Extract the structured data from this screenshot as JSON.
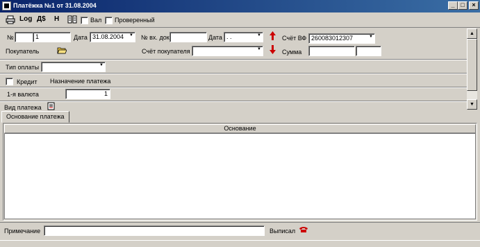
{
  "window": {
    "title": "Платёжка №1 от 31.08.2004",
    "min_label": "_",
    "max_label": "□",
    "close_label": "×"
  },
  "toolbar": {
    "print_icon": "printer-icon",
    "log_label": "Log",
    "ds_label": "Д$",
    "h_label": "Н",
    "book_icon": "book-icon",
    "val_label": "Вал",
    "checked_label": "Проверенный"
  },
  "form": {
    "number_label": "№",
    "number_value": "1",
    "date_label": "Дата",
    "date_value": "31.08.2004",
    "incoming_doc_label": "№ вх. док",
    "incoming_doc_value": "",
    "date2_label": "Дата",
    "date2_value": ". .",
    "invoice_account_label": "Счёт ВФ",
    "invoice_account_value": "260083012307",
    "buyer_label": "Покупатель",
    "buyer_account_label": "Счёт покупателя",
    "buyer_account_value": "",
    "sum_label": "Сумма",
    "sum_value1": "",
    "sum_value2": "",
    "payment_type_label": "Тип оплаты",
    "payment_type_value": "",
    "credit_label": "Кредит",
    "purpose_label": "Назначение платежа",
    "currency_label": "1-я валюта",
    "currency_value": "1",
    "payment_kind_label": "Вид платежа"
  },
  "tabs": [
    {
      "label": "Основание платежа"
    }
  ],
  "grid": {
    "header": "Основание"
  },
  "bottom": {
    "note_label": "Примечание",
    "note_value": "",
    "issued_label": "Выписал"
  },
  "colors": {
    "title_start": "#0a246a",
    "title_end": "#3a6ea5",
    "face": "#d4d0c8",
    "arrow_red": "#cc0000"
  }
}
